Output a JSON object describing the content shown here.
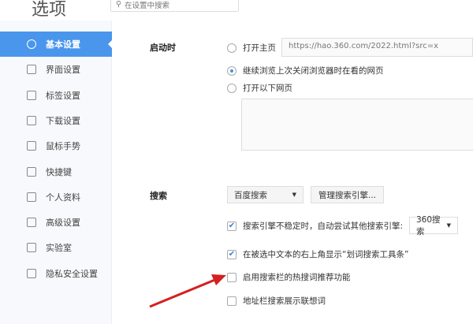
{
  "title": "选项",
  "search": {
    "placeholder": "在设置中搜索"
  },
  "sidebar": {
    "items": [
      {
        "label": "基本设置",
        "icon": "gear-icon",
        "active": true
      },
      {
        "label": "界面设置",
        "icon": "window-icon"
      },
      {
        "label": "标签设置",
        "icon": "tab-icon"
      },
      {
        "label": "下载设置",
        "icon": "download-icon"
      },
      {
        "label": "鼠标手势",
        "icon": "mouse-icon"
      },
      {
        "label": "快捷键",
        "icon": "keyboard-icon"
      },
      {
        "label": "个人资料",
        "icon": "user-icon"
      },
      {
        "label": "高级设置",
        "icon": "wrench-icon"
      },
      {
        "label": "实验室",
        "icon": "flask-icon"
      },
      {
        "label": "隐私安全设置",
        "icon": "shield-icon"
      }
    ]
  },
  "startup": {
    "label": "启动时",
    "options": [
      "打开主页",
      "继续浏览上次关闭浏览器时在看的网页",
      "打开以下网页"
    ],
    "homepage_url": "https://hao.360.com/2022.html?src=x"
  },
  "search_section": {
    "label": "搜索",
    "engine": "百度搜索",
    "manage_button": "管理搜索引擎...",
    "options": [
      {
        "label": "搜索引擎不稳定时，自动尝试其他搜索引擎:",
        "checked": true,
        "fallback": "360搜索"
      },
      {
        "label": "在被选中文本的右上角显示“划词搜索工具条”",
        "checked": true
      },
      {
        "label": "启用搜索栏的热搜词推荐功能",
        "checked": false
      },
      {
        "label": "地址栏搜索展示联想词",
        "checked": false
      }
    ]
  },
  "colors": {
    "accent": "#4a96ec",
    "arrow": "#d42020"
  }
}
